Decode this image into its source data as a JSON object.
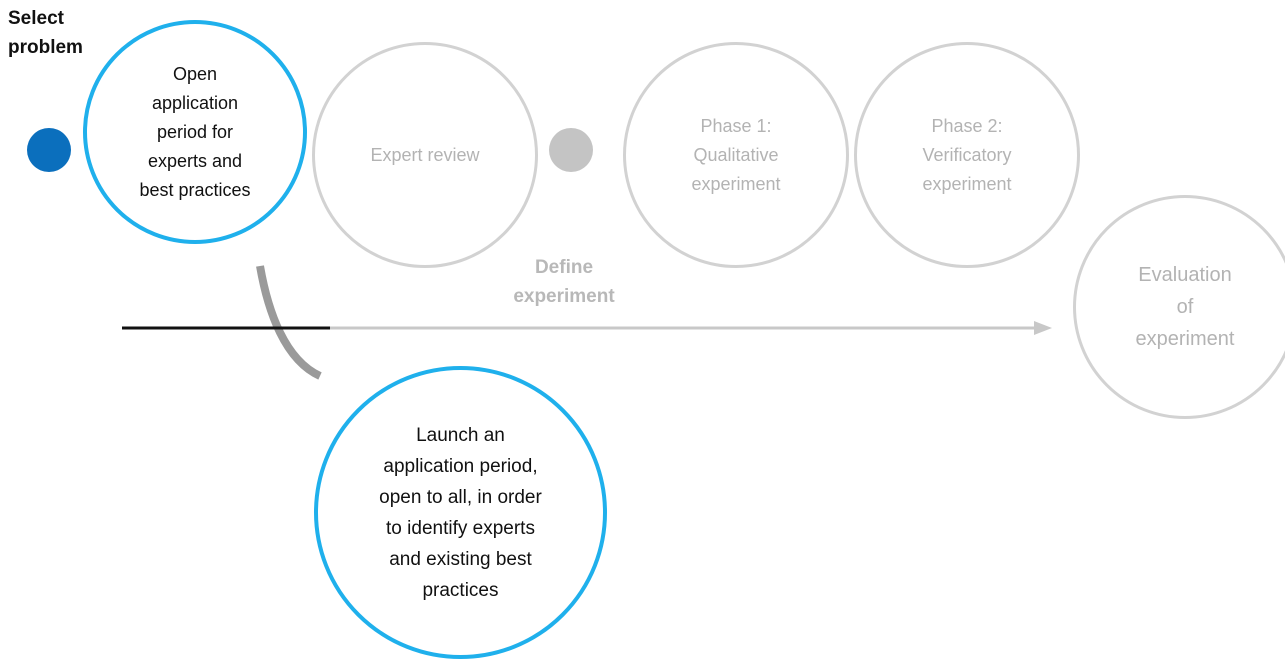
{
  "title": "Select\nproblem",
  "define_label": "Define\nexperiment",
  "nodes": {
    "open_application": "Open\napplication\nperiod for\nexperts and\nbest practices",
    "expert_review": "Expert review",
    "phase1": "Phase 1:\nQualitative\nexperiment",
    "phase2": "Phase 2:\nVerificatory\nexperiment",
    "evaluation": "Evaluation\nof\nexperiment",
    "launch": "Launch an\napplication period,\nopen to all, in order\nto identify experts\nand existing best\npractices"
  },
  "colors": {
    "active_ring": "#1fb0ec",
    "inactive_ring": "#d2d2d2",
    "active_dot": "#0b6fbd",
    "inactive_dot": "#c4c4c4",
    "timeline_done": "#111111",
    "timeline_todo": "#c8c8c8"
  }
}
